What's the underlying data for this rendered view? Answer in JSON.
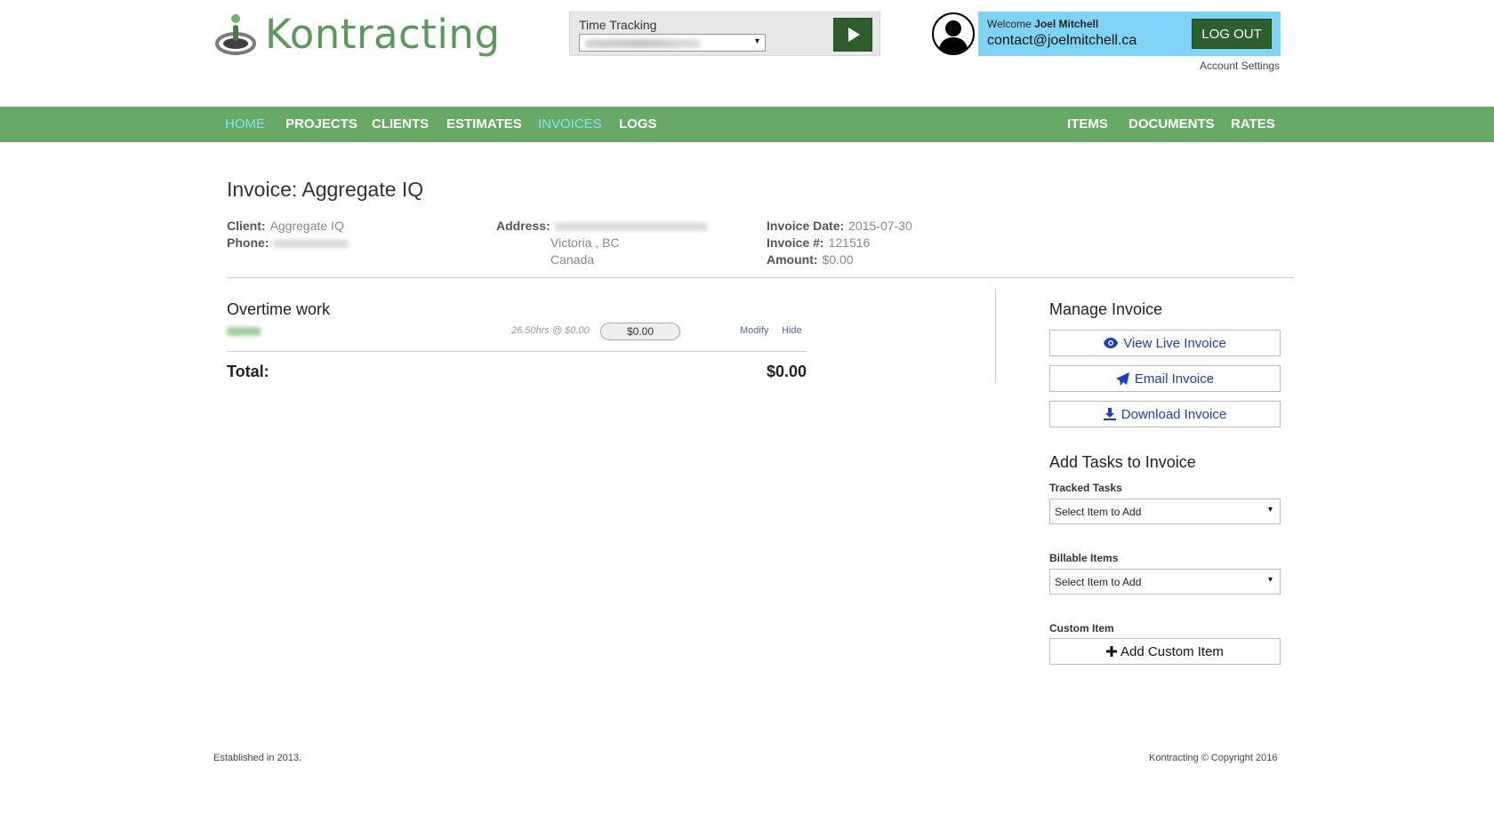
{
  "brand": {
    "name": "Kontracting",
    "color": "#5a9a58"
  },
  "time_tracking": {
    "label": "Time Tracking",
    "select_arrow": "▾",
    "play_icon": "play-icon"
  },
  "user": {
    "welcome_prefix": "Welcome",
    "name": "Joel Mitchell",
    "email": "contact@joelmitchell.ca",
    "logout_label": "LOG OUT",
    "account_settings_label": "Account Settings"
  },
  "nav": {
    "left": [
      {
        "label": "HOME",
        "active": true
      },
      {
        "label": "PROJECTS",
        "active": false
      },
      {
        "label": "CLIENTS",
        "active": false
      },
      {
        "label": "ESTIMATES",
        "active": false
      },
      {
        "label": "INVOICES",
        "active": true
      },
      {
        "label": "LOGS",
        "active": false
      }
    ],
    "right": [
      {
        "label": "ITEMS"
      },
      {
        "label": "DOCUMENTS"
      },
      {
        "label": "RATES"
      }
    ],
    "bar_color": "#67aa66",
    "active_color": "#8fdcf9"
  },
  "invoice": {
    "title": "Invoice: Aggregate IQ",
    "client_label": "Client:",
    "client_value": "Aggregate IQ",
    "phone_label": "Phone:",
    "address_label": "Address:",
    "address_city": "Victoria , BC",
    "address_country": "Canada",
    "date_label": "Invoice Date:",
    "date_value": "2015-07-30",
    "number_label": "Invoice #:",
    "number_value": "121516",
    "amount_label": "Amount:",
    "amount_value": "$0.00"
  },
  "group": {
    "title": "Overtime work",
    "line_rate": "26.50hrs @ $0.00",
    "line_amount": "$0.00",
    "modify_label": "Modify",
    "hide_label": "Hide",
    "total_label": "Total:",
    "total_value": "$0.00"
  },
  "manage": {
    "title": "Manage Invoice",
    "view_live": "View Live Invoice",
    "email": "Email Invoice",
    "download": "Download Invoice",
    "accent": "#1a3dc9"
  },
  "add_tasks": {
    "title": "Add Tasks to Invoice",
    "tracked_label": "Tracked Tasks",
    "tracked_value": "Select Item to Add",
    "billable_label": "Billable Items",
    "billable_value": "Select Item to Add",
    "custom_label": "Custom Item",
    "custom_button": "Add Custom Item",
    "select_arrow": "▾"
  },
  "footer": {
    "left": "Established in 2013.",
    "right": "Kontracting © Copyright 2016"
  }
}
